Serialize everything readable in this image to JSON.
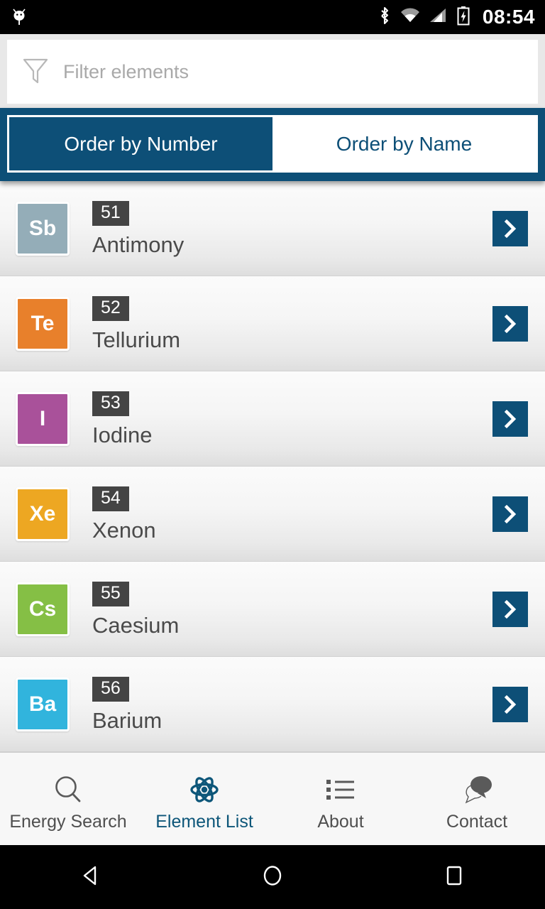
{
  "status_bar": {
    "time": "08:54",
    "icons": [
      "android-robot-icon",
      "bluetooth-icon",
      "wifi-icon",
      "cell-signal-icon",
      "battery-charging-icon"
    ]
  },
  "search": {
    "placeholder": "Filter elements",
    "value": "",
    "icon": "filter-funnel-icon"
  },
  "tabs": [
    {
      "label": "Order by Number",
      "active": true
    },
    {
      "label": "Order by Name",
      "active": false
    }
  ],
  "colors": {
    "accent": "#0d4f77",
    "badge": "#444444",
    "row_text": "#4a4a4a",
    "nav_label": "#4f4f4f"
  },
  "elements": [
    {
      "symbol": "Sb",
      "number": "51",
      "name": "Antimony",
      "color": "#94adb8",
      "chevron": "chevron-right-icon"
    },
    {
      "symbol": "Te",
      "number": "52",
      "name": "Tellurium",
      "color": "#e8802b",
      "chevron": "chevron-right-icon"
    },
    {
      "symbol": "I",
      "number": "53",
      "name": "Iodine",
      "color": "#a9519a",
      "chevron": "chevron-right-icon"
    },
    {
      "symbol": "Xe",
      "number": "54",
      "name": "Xenon",
      "color": "#eda722",
      "chevron": "chevron-right-icon"
    },
    {
      "symbol": "Cs",
      "number": "55",
      "name": "Caesium",
      "color": "#85bf45",
      "chevron": "chevron-right-icon"
    },
    {
      "symbol": "Ba",
      "number": "56",
      "name": "Barium",
      "color": "#31b4dd",
      "chevron": "chevron-right-icon"
    }
  ],
  "bottom_nav": [
    {
      "label": "Energy Search",
      "icon": "magnifier-icon",
      "active": false
    },
    {
      "label": "Element List",
      "icon": "atom-icon",
      "active": true
    },
    {
      "label": "About",
      "icon": "list-icon",
      "active": false
    },
    {
      "label": "Contact",
      "icon": "chat-bubble-icon",
      "active": false
    }
  ],
  "android_nav": [
    {
      "label": "Back",
      "icon": "back-triangle-icon"
    },
    {
      "label": "Home",
      "icon": "home-circle-icon"
    },
    {
      "label": "Recents",
      "icon": "recents-square-icon"
    }
  ]
}
